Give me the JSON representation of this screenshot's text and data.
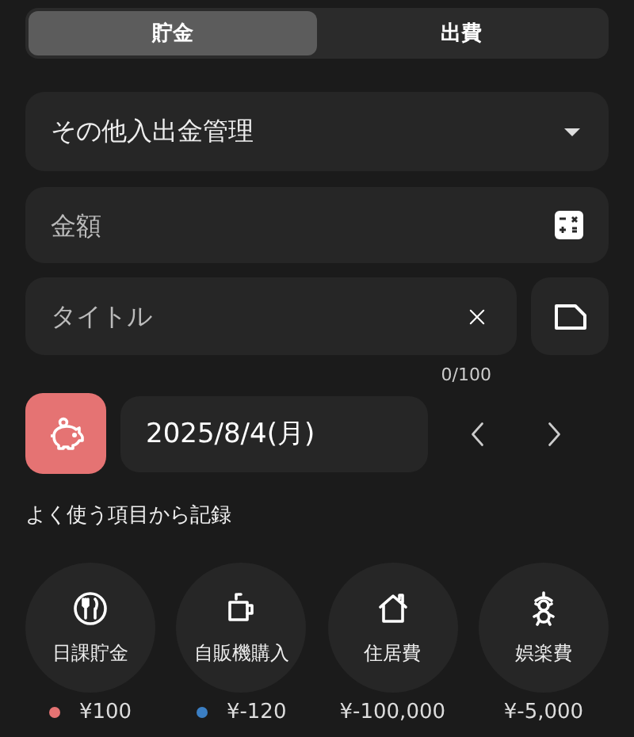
{
  "tabs": [
    {
      "label": "貯金",
      "selected": true
    },
    {
      "label": "出費",
      "selected": false
    }
  ],
  "category": {
    "value": "その他入出金管理"
  },
  "amount": {
    "placeholder": "金額"
  },
  "title": {
    "placeholder": "タイトル",
    "counter": "0/100"
  },
  "date": {
    "value": "2025/8/4(月)"
  },
  "favorites": {
    "heading": "よく使う項目から記録",
    "items": [
      {
        "label": "日課貯金",
        "amount": "¥100",
        "color": "#e57373"
      },
      {
        "label": "自販機購入",
        "amount": "¥-120",
        "color": "#3b7fc4"
      },
      {
        "label": "住居費",
        "amount": "¥-100,000"
      },
      {
        "label": "娯楽費",
        "amount": "¥-5,000"
      }
    ]
  }
}
